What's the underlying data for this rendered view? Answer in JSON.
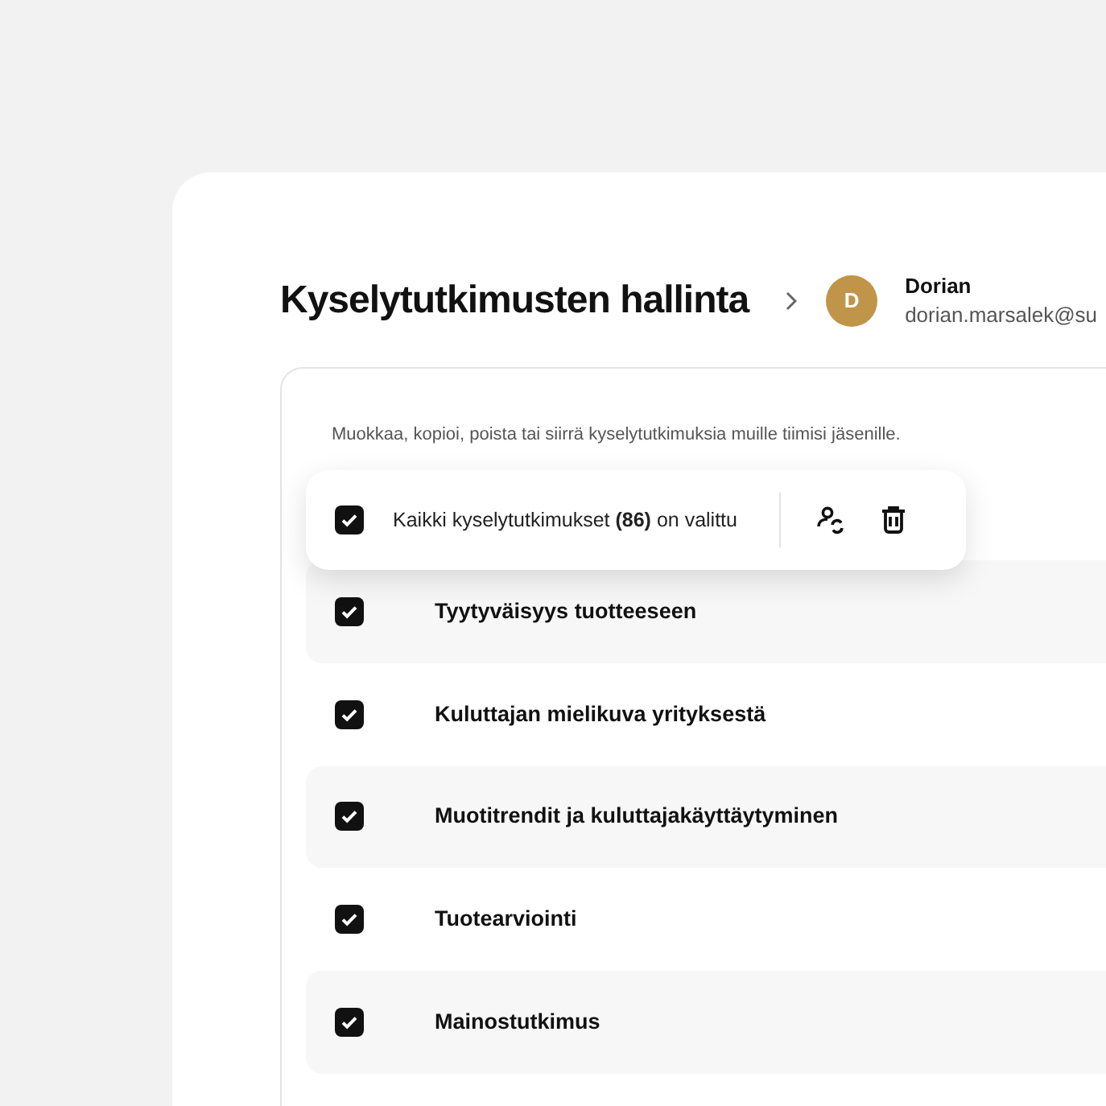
{
  "title": "Kyselytutkimusten hallinta",
  "user": {
    "initial": "D",
    "name": "Dorian",
    "email": "dorian.marsalek@su",
    "color": "#c0954a"
  },
  "description": "Muokkaa, kopioi, poista tai siirrä kyselytutkimuksia muille tiimisi jäsenille.",
  "selection_bar": {
    "checked": true,
    "text": "Kaikki kyselytutkimukset **(86)** on valittu"
  },
  "surveys": [
    {
      "title": "Tyytyväisyys tuotteeseen",
      "checked": true
    },
    {
      "title": "Kuluttajan mielikuva yrityksestä",
      "checked": true
    },
    {
      "title": "Muotitrendit ja kuluttajakäyttäytyminen",
      "checked": true
    },
    {
      "title": "Tuotearviointi",
      "checked": true
    },
    {
      "title": "Mainostutkimus",
      "checked": true
    }
  ]
}
